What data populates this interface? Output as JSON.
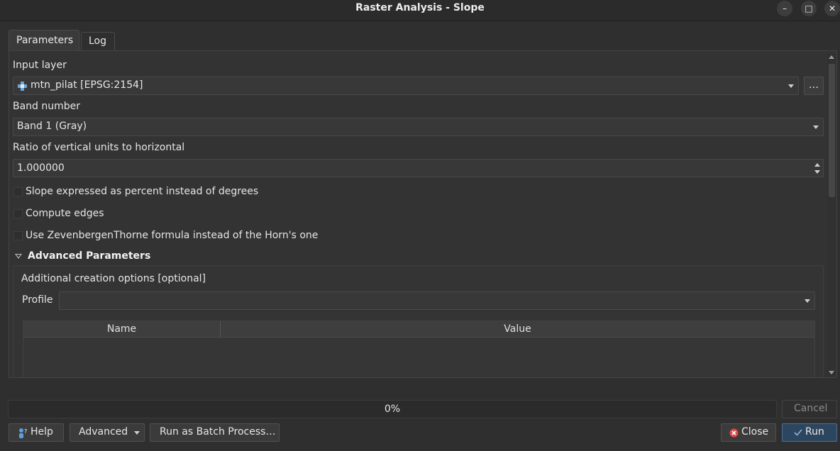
{
  "window": {
    "title": "Raster Analysis - Slope",
    "controls": {
      "minimize": "–",
      "maximize": "□",
      "close": "✕"
    }
  },
  "tabs": [
    {
      "label": "Parameters",
      "active": true
    },
    {
      "label": "Log",
      "active": false
    }
  ],
  "form": {
    "input_layer": {
      "label": "Input layer",
      "value": "mtn_pilat [EPSG:2154]",
      "browse_label": "…",
      "icon": "raster-layer-icon"
    },
    "band_number": {
      "label": "Band number",
      "value": "Band 1 (Gray)"
    },
    "ratio": {
      "label": "Ratio of vertical units to horizontal",
      "value": "1.000000"
    },
    "checkboxes": [
      {
        "label": "Slope expressed as percent instead of degrees",
        "checked": false
      },
      {
        "label": "Compute edges",
        "checked": false
      },
      {
        "label": "Use ZevenbergenThorne formula instead of the Horn's one",
        "checked": false
      }
    ]
  },
  "advanced": {
    "heading": "Advanced Parameters",
    "expanded": true,
    "creation_options_label": "Additional creation options [optional]",
    "profile_label": "Profile",
    "profile_value": "",
    "table_headers": [
      "Name",
      "Value"
    ]
  },
  "progress": {
    "value_percent": 0,
    "text": "0%"
  },
  "buttons": {
    "cancel": "Cancel",
    "help": "Help",
    "advanced": "Advanced",
    "batch": "Run as Batch Process…",
    "close": "Close",
    "run": "Run"
  },
  "colors": {
    "background": "#2f2f2f",
    "accent": "#4b6f96",
    "close_icon": "#e04b4b"
  }
}
